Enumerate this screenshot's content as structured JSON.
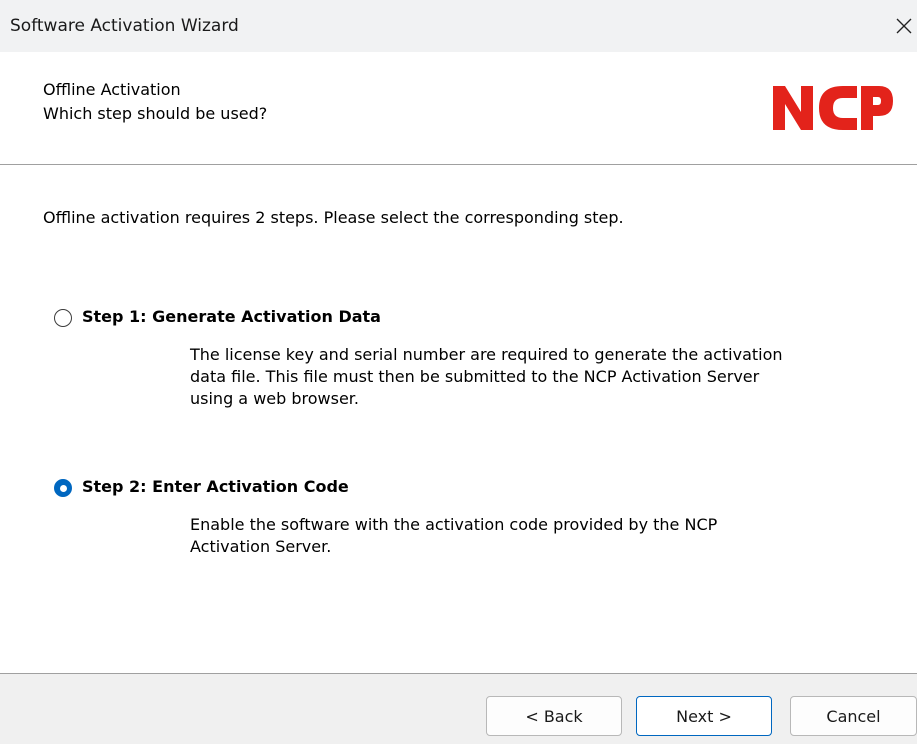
{
  "window": {
    "title": "Software Activation Wizard"
  },
  "header": {
    "title": "Offline Activation",
    "subtitle": "Which step should be used?",
    "logo_text": "NCP",
    "logo_color": "#e3231b"
  },
  "content": {
    "intro": "Offline activation requires 2 steps. Please select the corresponding step.",
    "options": [
      {
        "label": "Step 1: Generate Activation Data",
        "selected": false,
        "description_lines": [
          "The license key and serial number are required to generate the activation",
          "data file. This file must then be submitted to the NCP Activation Server",
          "using a web browser."
        ]
      },
      {
        "label": "Step 2: Enter Activation Code",
        "selected": true,
        "description_lines": [
          "Enable the software with the activation code provided by the NCP",
          "Activation Server."
        ]
      }
    ]
  },
  "footer": {
    "back_label": "< Back",
    "next_label": "Next >",
    "cancel_label": "Cancel"
  },
  "colors": {
    "accent": "#0067c0",
    "titlebar_bg": "#f1f2f3",
    "footer_bg": "#f0f0f0"
  }
}
